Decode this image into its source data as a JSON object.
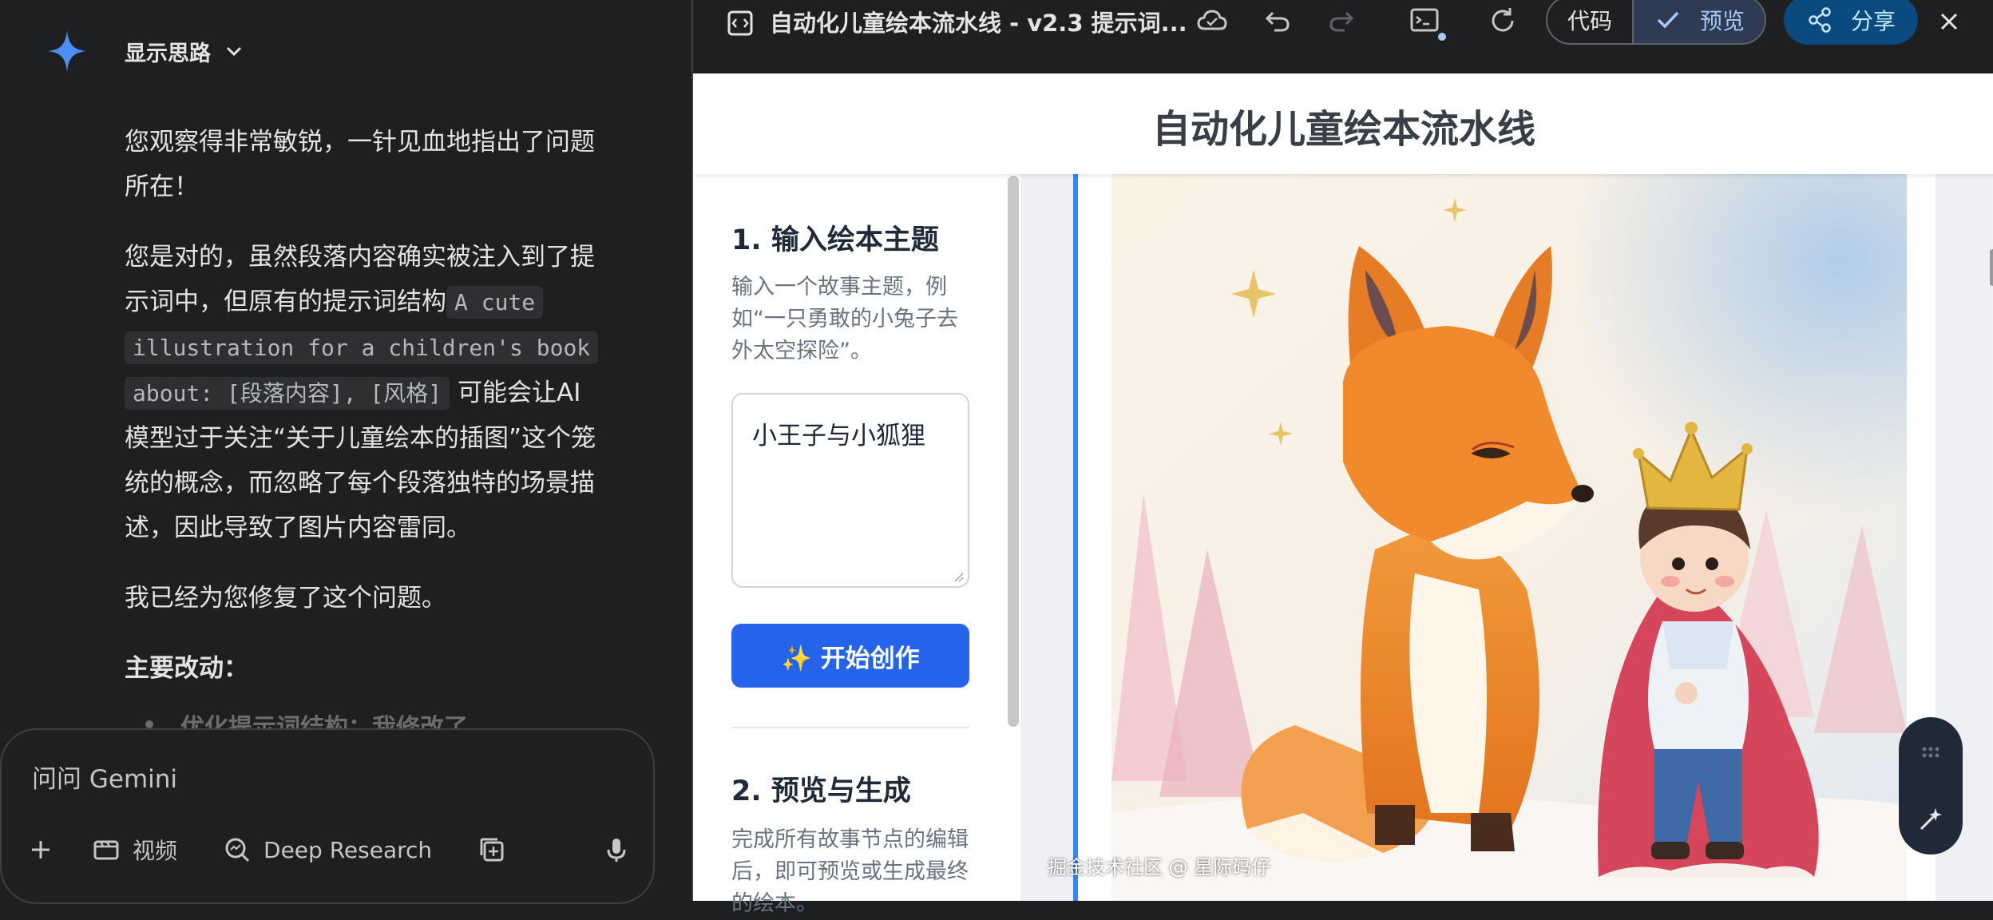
{
  "chat": {
    "thinking_label": "显示思路",
    "message": {
      "p1": "您观察得非常敏锐，一针见血地指出了问题所在！",
      "p2_before": "您是对的，虽然段落内容确实被注入到了提示词中，但原有的提示词结构",
      "p2_code": "A cute illustration for a children's book about: [段落内容], [风格]",
      "p2_after": "可能会让AI模型过于关注“关于儿童绘本的插图”这个笼统的概念，而忽略了每个段落独特的场景描述，因此导致了图片内容雷同。",
      "p3": "我已经为您修复了这个问题。",
      "heading": "主要改动：",
      "bullet_partial": "优化提示词结构：我修改了"
    },
    "composer": {
      "placeholder": "问问 Gemini",
      "tools": [
        "视频",
        "Deep Research"
      ]
    }
  },
  "canvas": {
    "doc_title": "自动化儿童绘本流水线 - v2.3 提示词...",
    "toggle": {
      "code": "代码",
      "preview": "预览"
    },
    "share": "分享",
    "page_title": "自动化儿童绘本流水线",
    "section1": {
      "title": "1. 输入绘本主题",
      "desc": "输入一个故事主题，例如“一只勇敢的小兔子去外太空探险”。",
      "input_value": "小王子与小狐狸",
      "button": "✨ 开始创作"
    },
    "section2": {
      "title": "2. 预览与生成",
      "desc": "完成所有故事节点的编辑后，即可预览或生成最终的绘本。"
    }
  },
  "watermark": "掘金技术社区 @ 星际码仔",
  "colors": {
    "accent_blue": "#2563eb",
    "preview_active": "#a8c7fa",
    "share_bg": "#0b4a7e",
    "gemini_spark": "#4b8ef5"
  },
  "icons": [
    "gemini-spark-icon",
    "chevron-down-icon",
    "plus-icon",
    "video-icon",
    "research-icon",
    "add-doc-icon",
    "mic-icon",
    "doc-icon",
    "cloud-icon",
    "undo-icon",
    "redo-icon",
    "console-icon",
    "refresh-icon",
    "check-icon",
    "share-icon",
    "close-icon",
    "edit-sparkle-icon"
  ]
}
